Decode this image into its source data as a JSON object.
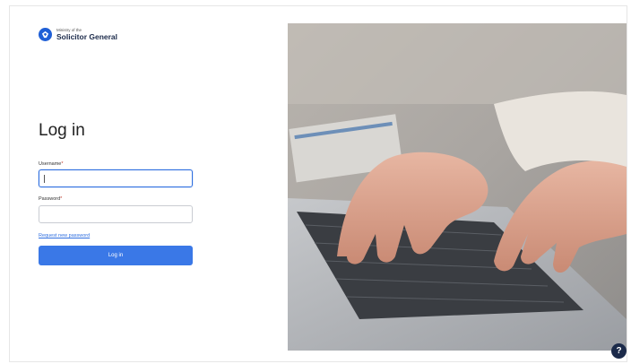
{
  "brand": {
    "line1": "Ministry of the",
    "line2": "Solicitor General"
  },
  "login": {
    "title": "Log in",
    "username_label": "Username",
    "password_label": "Password",
    "required_mark": "*",
    "reset_link": "Request new password",
    "submit_label": "Log in"
  },
  "help": {
    "label": "?"
  },
  "colors": {
    "primary": "#3a78e7",
    "brand": "#1f5fd6",
    "help_bg": "#1b2a4a"
  },
  "icons": {
    "brand_mark": "trillium-logo-icon",
    "help": "help-icon"
  }
}
